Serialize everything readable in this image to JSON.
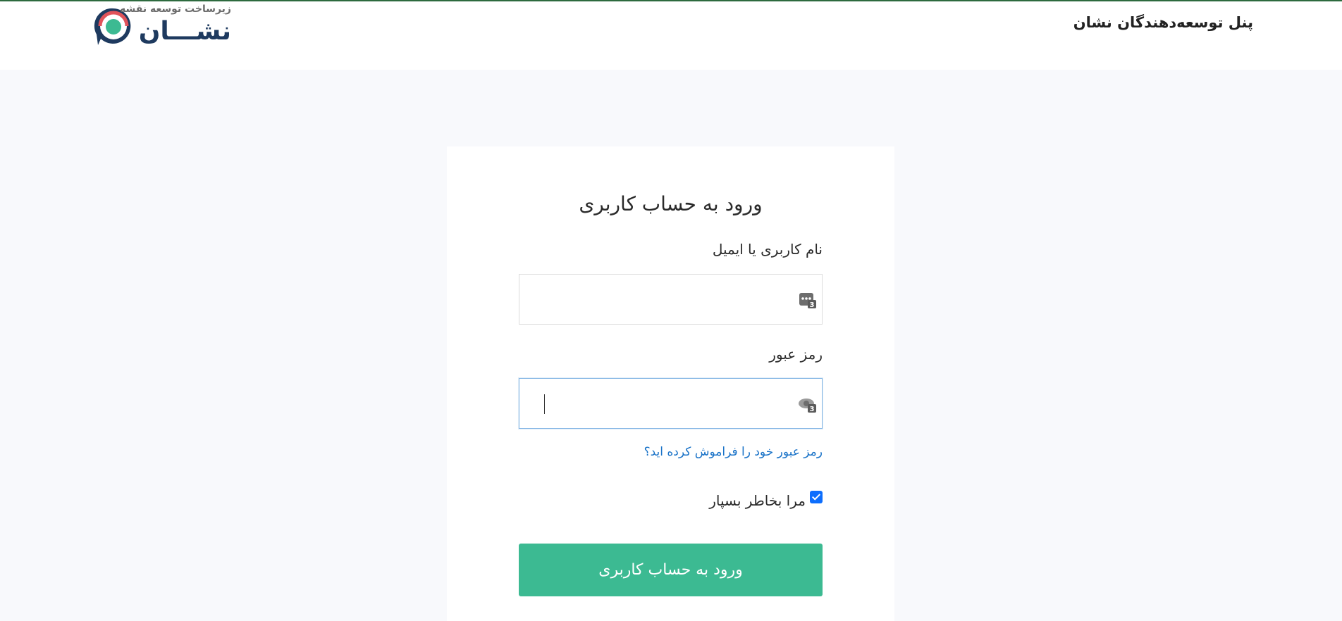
{
  "header": {
    "panel_title": "پنل توسعه‌دهندگان نشان",
    "logo": {
      "tagline": "زیرساخت توسعه نقشه",
      "name": "نشـــان"
    }
  },
  "login": {
    "title": "ورود به حساب کاربری",
    "username_label": "نام کاربری یا ایمیل",
    "username_value": "",
    "password_label": "رمز عبور",
    "password_value": "",
    "forgot_link": "رمز عبور خود را فراموش کرده اید؟",
    "remember_label": "مرا بخاطر بسپار",
    "remember_checked": true,
    "submit_label": "ورود به حساب کاربری",
    "extension_badge": "3"
  },
  "colors": {
    "accent": "#3cba92",
    "link": "#1a73c8",
    "checkbox": "#0d6efd",
    "logo_text": "#1e3a5f",
    "logo_ring": "#e0535a",
    "logo_dot": "#3cba92"
  }
}
